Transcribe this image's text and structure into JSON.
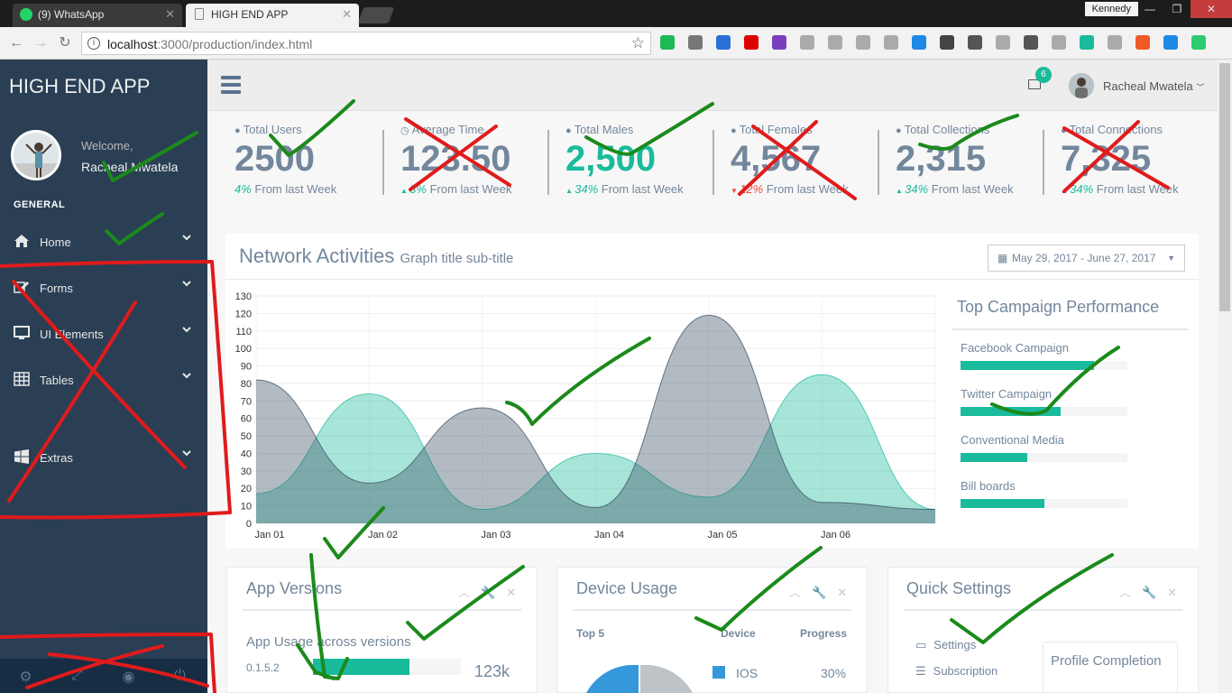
{
  "browser": {
    "tabs": [
      {
        "title": "(9) WhatsApp",
        "active": false,
        "icon": "whatsapp-icon",
        "color": "#25d366"
      },
      {
        "title": "HIGH END APP",
        "active": true,
        "icon": "page-icon",
        "color": "#888888"
      }
    ],
    "profile_name": "Kennedy",
    "url_host": "localhost",
    "url_path": ":3000/production/index.html"
  },
  "sidebar": {
    "brand": "HIGH END APP",
    "welcome": "Welcome,",
    "user_name": "Racheal Mwatela",
    "section": "GENERAL",
    "items": [
      {
        "label": "Home",
        "icon": "home-icon"
      },
      {
        "label": "Forms",
        "icon": "edit-icon"
      },
      {
        "label": "UI Elements",
        "icon": "desktop-icon"
      },
      {
        "label": "Tables",
        "icon": "table-icon"
      },
      {
        "label": "Extras",
        "icon": "windows-icon"
      }
    ],
    "footer_icons": [
      "gear-icon",
      "fullscreen-icon",
      "eye-slash-icon",
      "power-icon"
    ]
  },
  "topnav": {
    "mail_count": "6",
    "user_name": "Racheal Mwatela"
  },
  "tiles": [
    {
      "label": "Total Users",
      "icon": "user-icon",
      "value": "2500",
      "pct": "4%",
      "suffix": "From last Week",
      "trend": "none",
      "green": false
    },
    {
      "label": "Average Time",
      "icon": "clock-icon",
      "value": "123.50",
      "pct": "3%",
      "suffix": "From last Week",
      "trend": "up",
      "green": false
    },
    {
      "label": "Total Males",
      "icon": "user-icon",
      "value": "2,500",
      "pct": "34%",
      "suffix": "From last Week",
      "trend": "up",
      "green": true
    },
    {
      "label": "Total Females",
      "icon": "user-icon",
      "value": "4,567",
      "pct": "12%",
      "suffix": "From last Week",
      "trend": "down",
      "green": false
    },
    {
      "label": "Total Collections",
      "icon": "user-icon",
      "value": "2,315",
      "pct": "34%",
      "suffix": "From last Week",
      "trend": "up",
      "green": false
    },
    {
      "label": "Total Connections",
      "icon": "user-icon",
      "value": "7,325",
      "pct": "34%",
      "suffix": "From last Week",
      "trend": "up",
      "green": false
    }
  ],
  "network": {
    "title": "Network Activities",
    "subtitle": "Graph title sub-title",
    "date_range": "May 29, 2017 - June 27, 2017"
  },
  "campaign": {
    "title": "Top Campaign Performance",
    "items": [
      {
        "label": "Facebook Campaign",
        "progress": 0.8
      },
      {
        "label": "Twitter Campaign",
        "progress": 0.6
      },
      {
        "label": "Conventional Media",
        "progress": 0.4
      },
      {
        "label": "Bill boards",
        "progress": 0.5
      }
    ]
  },
  "panels": {
    "app_versions": {
      "title": "App Versions",
      "subtitle": "App Usage across versions",
      "version": "0.1.5.2",
      "value": "123k",
      "progress": 0.65
    },
    "device_usage": {
      "title": "Device Usage",
      "col1": "Top 5",
      "col2": "Device",
      "col3": "Progress",
      "row_device": "IOS",
      "row_pct": "30%",
      "row_color": "#3498db"
    },
    "quick_settings": {
      "title": "Quick Settings",
      "items": [
        "Settings",
        "Subscription"
      ],
      "profile": "Profile Completion"
    }
  },
  "chart_data": {
    "type": "area",
    "categories": [
      "Jan 01",
      "Jan 02",
      "Jan 03",
      "Jan 04",
      "Jan 05",
      "Jan 06"
    ],
    "ylim": [
      0,
      130
    ],
    "yticks": [
      0,
      10,
      20,
      30,
      40,
      50,
      60,
      70,
      80,
      90,
      100,
      110,
      120,
      130
    ],
    "grid": true,
    "series": [
      {
        "color": "#1abb9c",
        "opacity": 0.38,
        "x": [
          0,
          1,
          2,
          3,
          4,
          5,
          6
        ],
        "values": [
          17,
          74,
          8,
          40,
          15,
          85,
          8
        ]
      },
      {
        "color": "#34495e",
        "opacity": 0.38,
        "x": [
          0,
          1,
          2,
          3,
          4,
          5,
          6
        ],
        "values": [
          82,
          23,
          66,
          9,
          119,
          12,
          8
        ]
      }
    ]
  }
}
